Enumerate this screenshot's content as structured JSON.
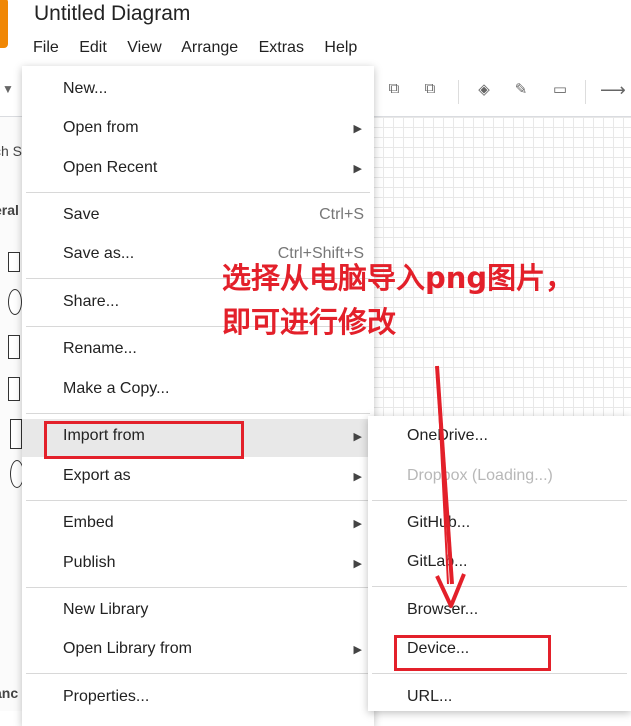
{
  "app": {
    "title": "Untitled Diagram",
    "menubar": [
      "File",
      "Edit",
      "View",
      "Arrange",
      "Extras",
      "Help"
    ]
  },
  "sidebar": {
    "search_fragment": "ch S",
    "general_fragment": "eral",
    "bottom_fragment": "anc"
  },
  "file_menu": {
    "new": "New...",
    "open_from": "Open from",
    "open_recent": "Open Recent",
    "save": "Save",
    "save_shortcut": "Ctrl+S",
    "save_as": "Save as...",
    "save_as_shortcut": "Ctrl+Shift+S",
    "share": "Share...",
    "rename": "Rename...",
    "make_copy": "Make a Copy...",
    "import_from": "Import from",
    "export_as": "Export as",
    "embed": "Embed",
    "publish": "Publish",
    "new_library": "New Library",
    "open_library_from": "Open Library from",
    "properties": "Properties..."
  },
  "import_submenu": {
    "onedrive": "OneDrive...",
    "dropbox": "Dropbox (Loading...)",
    "github": "GitHub...",
    "gitlab": "GitLab...",
    "browser": "Browser...",
    "device": "Device...",
    "url": "URL..."
  },
  "annotation": {
    "line1": "选择从电脑导入png图片，",
    "line2": "即可进行修改",
    "color": "#e3202a"
  },
  "colors": {
    "accent_logo": "#f08705",
    "highlight": "#e8e8e8",
    "annotation_red": "#e3202a"
  }
}
